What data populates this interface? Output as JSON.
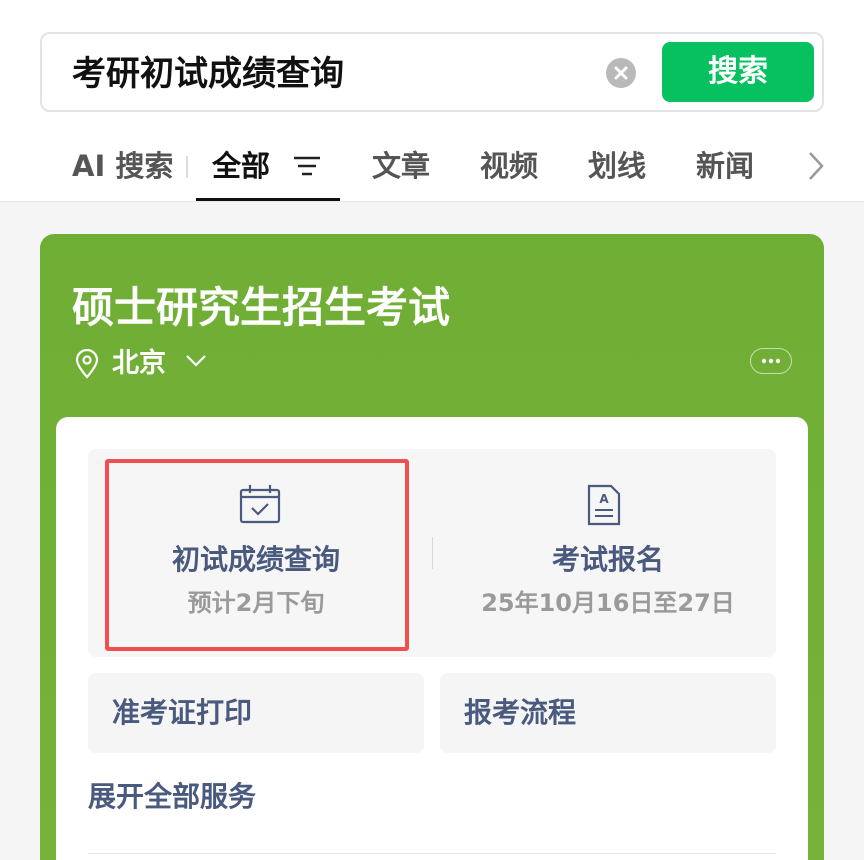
{
  "search": {
    "query": "考研初试成绩查询",
    "button_label": "搜索"
  },
  "tabs": [
    {
      "label": "AI 搜索"
    },
    {
      "label": "全部"
    },
    {
      "label": "文章"
    },
    {
      "label": "视频"
    },
    {
      "label": "划线"
    },
    {
      "label": "新闻"
    }
  ],
  "card": {
    "title": "硕士研究生招生考试",
    "location": "北京",
    "services": [
      {
        "title": "初试成绩查询",
        "subtitle": "预计2月下旬",
        "icon": "calendar-check-icon"
      },
      {
        "title": "考试报名",
        "subtitle": "25年10月16日至27日",
        "icon": "document-a-icon"
      }
    ],
    "links": [
      {
        "label": "准考证打印"
      },
      {
        "label": "报考流程"
      }
    ],
    "expand_label": "展开全部服务"
  },
  "colors": {
    "brand_green": "#07c160",
    "card_green": "#72af37",
    "service_text": "#4a5a7e",
    "highlight_red": "#f0504f"
  }
}
